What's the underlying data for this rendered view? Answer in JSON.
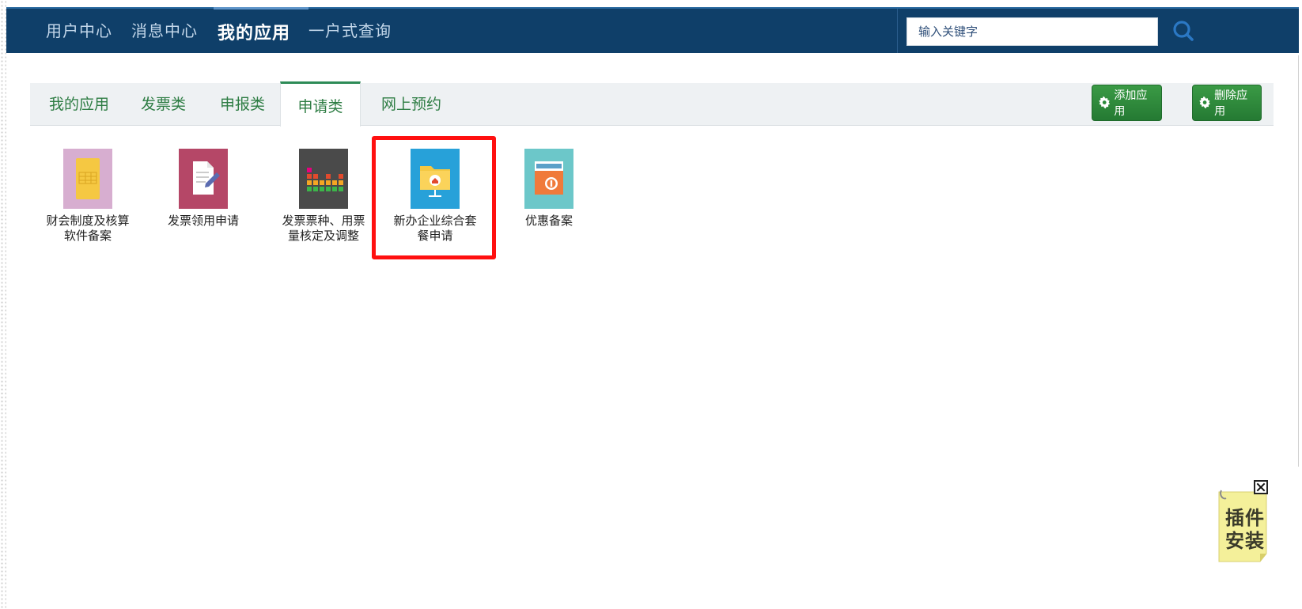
{
  "topnav": {
    "items": [
      {
        "label": "用户中心",
        "active": false
      },
      {
        "label": "消息中心",
        "active": false
      },
      {
        "label": "我的应用",
        "active": true
      },
      {
        "label": "一户式查询",
        "active": false
      }
    ],
    "search_placeholder": "输入关键字"
  },
  "tabs": {
    "items": [
      {
        "label": "我的应用",
        "active": false
      },
      {
        "label": "发票类",
        "active": false
      },
      {
        "label": "申报类",
        "active": false
      },
      {
        "label": "申请类",
        "active": true
      },
      {
        "label": "网上预约",
        "active": false
      }
    ],
    "add_label": "添加应用",
    "delete_label": "删除应用"
  },
  "apps": [
    {
      "label": "财会制度及核算软件备案",
      "line1": "财会制度及核算",
      "line2": "软件备案",
      "icon": "document-yellow-icon",
      "color": "#d7aed0"
    },
    {
      "label": "发票领用申请",
      "line1": "发票领用申请",
      "line2": "",
      "icon": "edit-document-icon",
      "color": "#b54767"
    },
    {
      "label": "发票票种、用票量核定及调整",
      "line1": "发票票种、用票",
      "line2": "量核定及调整",
      "icon": "equalizer-icon",
      "color": "#4a4a4a"
    },
    {
      "label": "新办企业综合套餐申请",
      "line1": "新办企业综合套",
      "line2": "餐申请",
      "icon": "home-folder-icon",
      "color": "#27a1d9",
      "highlighted": true
    },
    {
      "label": "优惠备案",
      "line1": "优惠备案",
      "line2": "",
      "icon": "discount-card-icon",
      "color": "#6cc7c9"
    }
  ],
  "plugin": {
    "line1": "插件",
    "line2": "安装"
  },
  "colors": {
    "topbar": "#0f3f69",
    "accent_green": "#2e8b57",
    "highlight": "#ff1010"
  }
}
